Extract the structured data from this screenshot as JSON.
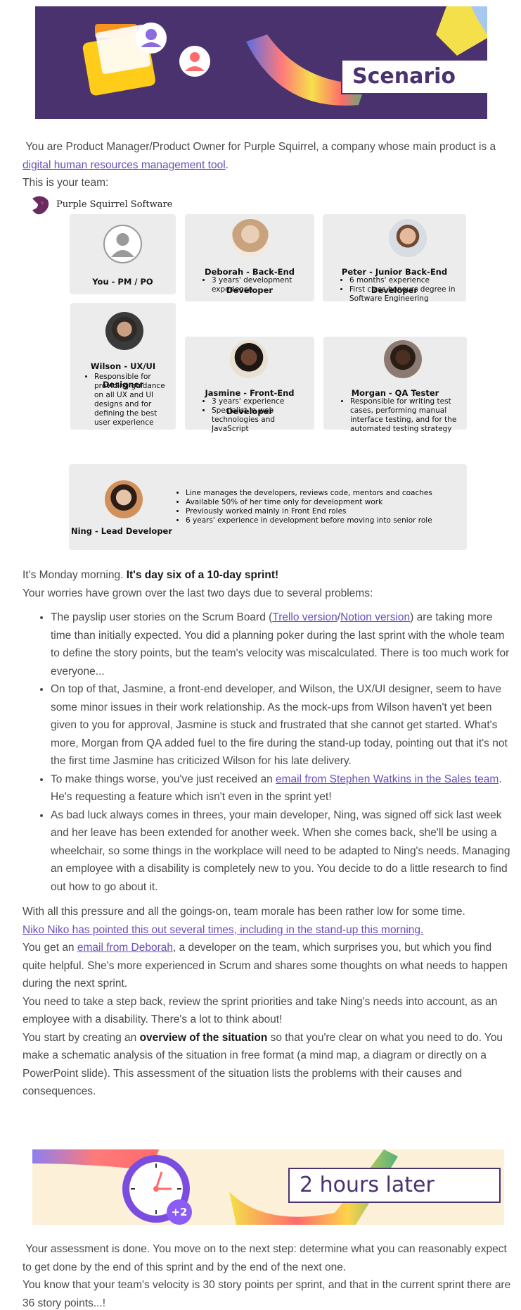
{
  "banner1": {
    "title": "Scenario"
  },
  "intro": {
    "line1_pre": "You are Product Manager/Product Owner for Purple Squirrel, a company whose main product is a ",
    "line1_link": "digital human resources management tool",
    "line1_post": ".",
    "line2": "This is your team:"
  },
  "team": {
    "logo_text": "Purple Squirrel Software",
    "members": [
      {
        "name": "You - PM / PO",
        "bullets": []
      },
      {
        "name": "Deborah - Back-End Developer",
        "bullets": [
          "3 years' development experience"
        ]
      },
      {
        "name": "Peter - Junior Back-End Developer",
        "bullets": [
          "6 months' experience",
          "First class honours degree in Software Engineering"
        ]
      },
      {
        "name": "Wilson - UX/UI Designer",
        "bullets": [
          "Responsible for providing guidance on all UX and UI designs and for defining the best user experience"
        ]
      },
      {
        "name": "Jasmine - Front-End Developer",
        "bullets": [
          "3 years' experience",
          "Specialist in web technologies and JavaScript"
        ]
      },
      {
        "name": "Morgan - QA Tester",
        "bullets": [
          "Responsible for writing test cases, performing manual interface testing, and for the automated testing strategy"
        ]
      },
      {
        "name": "Ning - Lead Developer",
        "bullets": [
          "Line manages the developers, reviews code, mentors and coaches",
          "Available 50% of her time only for development work",
          "Previously worked mainly in Front End roles",
          "6 years' experience in development before moving into senior role"
        ]
      }
    ]
  },
  "situation": {
    "p1_pre": "It's Monday morning. ",
    "p1_bold": "It's day six of a 10-day sprint!",
    "p2": "Your worries have grown over the last two days due to several problems:",
    "bullets": {
      "b1_pre": "The payslip user stories on the Scrum Board (",
      "b1_link1": "Trello version",
      "b1_sep": "/",
      "b1_link2": "Notion version",
      "b1_post": ") are taking more time than initially expected. You did a planning poker during the last sprint with the whole team to define the story points, but the team's velocity was miscalculated. There is too much work for everyone...",
      "b2": "On top of that, Jasmine, a front-end developer, and Wilson, the UX/UI designer, seem to have some minor issues in their work relationship. As the mock-ups from Wilson haven't yet been given to you for approval, Jasmine is stuck and frustrated that she cannot get started. What's more, Morgan from QA added fuel to the fire during the stand-up today, pointing out that it's not the first time Jasmine has criticized Wilson for his late delivery.",
      "b3_pre": "To make things worse, you've just received an ",
      "b3_link": "email from Stephen Watkins in the Sales team",
      "b3_post": ". He's requesting a feature which isn't even in the sprint yet!",
      "b4": "As bad luck always comes in threes, your main developer, Ning, was signed off sick last week and her leave has been extended for another week. When she comes back, she'll be using a wheelchair, so some things in the workplace will need to be adapted to Ning's needs. Managing an employee with a disability is completely new to you. You decide to do a little research to find out how to go about it."
    },
    "p3": "With all this pressure and all the goings-on, team morale has been rather low for some time.",
    "p3_link": "Niko Niko has pointed this out several times, including in the stand-up this morning.",
    "p4_pre": "You get an ",
    "p4_link": "email from Deborah",
    "p4_post": ", a developer on the team, which surprises you, but which you find quite helpful. She's more experienced in Scrum and shares some thoughts on what needs to happen during the next sprint.",
    "p5": "You need to take a step back, review the sprint priorities and take Ning's needs into account, as an employee with a disability. There's a lot to think about!",
    "p6_pre": "You start by creating an ",
    "p6_bold": "overview of the situation",
    "p6_post": " so that you're clear on what you need to do. You make a schematic analysis of the situation in free format (a mind map, a diagram or directly on a PowerPoint slide). This assessment of the situation lists the problems with their causes and consequences."
  },
  "banner2": {
    "title": "2 hours later",
    "badge": "+2"
  },
  "later": {
    "p1": "Your assessment is done. You move on to the next step: determine what you can reasonably expect to get done by the end of this sprint and by the end of the next one.",
    "p2": "You know that your team's velocity is 30 story points per sprint, and that in the current sprint there are 36 story points...!"
  },
  "colors": {
    "banner": "#4a326e",
    "link": "#6b4fbb",
    "card": "#ececec",
    "banner2_bg": "#fcf1d8"
  }
}
